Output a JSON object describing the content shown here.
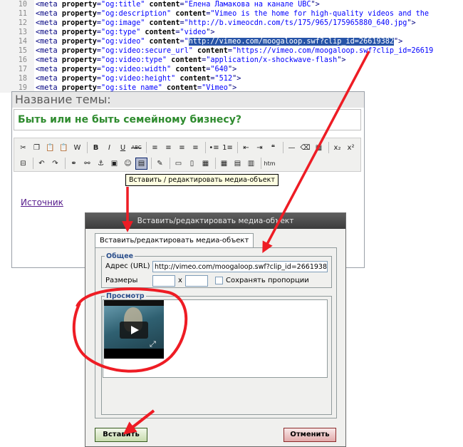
{
  "code": {
    "lines": [
      {
        "num": "10",
        "prop": "og:title",
        "content": "Елена Ламакова на канале UBC",
        "tail": "\">"
      },
      {
        "num": "11",
        "prop": "og:description",
        "content": "Vimeo is the home for high-quality videos and the",
        "tail": ""
      },
      {
        "num": "12",
        "prop": "og:image",
        "content": "http://b.vimeocdn.com/ts/175/965/175965880_640.jpg",
        "tail": "\">"
      },
      {
        "num": "13",
        "prop": "og:type",
        "content": "video",
        "tail": "\">"
      },
      {
        "num": "14",
        "prop": "og:video",
        "content": "http://vimeo.com/moogaloop.swf?clip_id=26619382",
        "tail": "\">"
      },
      {
        "num": "15",
        "prop": "og:video:secure_url",
        "content": "https://vimeo.com/moogaloop.swf?clip_id=26619",
        "tail": ""
      },
      {
        "num": "16",
        "prop": "og:video:type",
        "content": "application/x-shockwave-flash",
        "tail": "\">"
      },
      {
        "num": "17",
        "prop": "og:video:width",
        "content": "640",
        "tail": "\">"
      },
      {
        "num": "18",
        "prop": "og:video:height",
        "content": "512",
        "tail": "\">"
      },
      {
        "num": "19",
        "prop": "og:site_name",
        "content": "Vimeo",
        "tail": "\">"
      }
    ],
    "selected_line": "14"
  },
  "editor": {
    "topic_label": "Название темы:",
    "topic_value": "Быть или не быть семейному бизнесу?",
    "tooltip": "Вставить / редактировать медиа-объект",
    "source_link": "Источник",
    "toolbar_row1": [
      "scissors-icon",
      "copy-icon",
      "paste-icon",
      "paste-text-icon",
      "paste-word-icon",
      "sep",
      "bold-icon",
      "italic-icon",
      "underline-icon",
      "strikethrough-icon",
      "sep",
      "align-left-icon",
      "align-center-icon",
      "align-right-icon",
      "align-justify-icon",
      "sep",
      "bullet-list-icon",
      "number-list-icon",
      "sep",
      "outdent-icon",
      "indent-icon",
      "quote-icon",
      "sep",
      "hr-icon",
      "eraser-icon",
      "table-icon",
      "sep",
      "subscript-icon",
      "superscript-icon"
    ],
    "toolbar_row1_glyphs": [
      "✂",
      "❐",
      "📋",
      "📋",
      "W",
      "",
      "B",
      "I",
      "U",
      "ABC",
      "",
      "≡",
      "≡",
      "≡",
      "≡",
      "",
      "•≡",
      "1≡",
      "",
      "⇤",
      "⇥",
      "❝",
      "",
      "—",
      "⌫",
      "▦",
      "",
      "x₂",
      "x²"
    ],
    "toolbar_row2": [
      "page-break-icon",
      "sep",
      "undo-icon",
      "redo-icon",
      "sep",
      "link-icon",
      "unlink-icon",
      "anchor-icon",
      "image-icon",
      "emoticon-icon",
      "media-icon",
      "sep",
      "edit-icon",
      "sep",
      "table-row-icon",
      "table-col-icon",
      "table-merge-icon",
      "sep",
      "cell-props-icon",
      "row-props-icon",
      "delete-row-icon",
      "sep",
      "html-icon"
    ],
    "toolbar_row2_glyphs": [
      "⊟",
      "",
      "↶",
      "↷",
      "",
      "⚭",
      "⚯",
      "⚓",
      "▣",
      "☺",
      "▤",
      "",
      "✎",
      "",
      "▭",
      "▯",
      "▦",
      "",
      "▦",
      "▤",
      "▥",
      "",
      "htm"
    ]
  },
  "dialog": {
    "title": "Вставить/редактировать медиа-объект",
    "tab": "Вставить/редактировать медиа-объект",
    "general_legend": "Общее",
    "url_label": "Адрес (URL)",
    "url_value": "http://vimeo.com/moogaloop.swf?clip_id=26619382",
    "size_label": "Размеры",
    "size_sep": "x",
    "width_value": "",
    "height_value": "",
    "keep_ratio_label": "Сохранять пропорции",
    "preview_legend": "Просмотр",
    "insert_button": "Вставить",
    "cancel_button": "Отменить"
  },
  "colors": {
    "annotation_red": "#ee1c24",
    "selection_blue": "#2754a8",
    "topic_green": "#2e8b2e"
  }
}
